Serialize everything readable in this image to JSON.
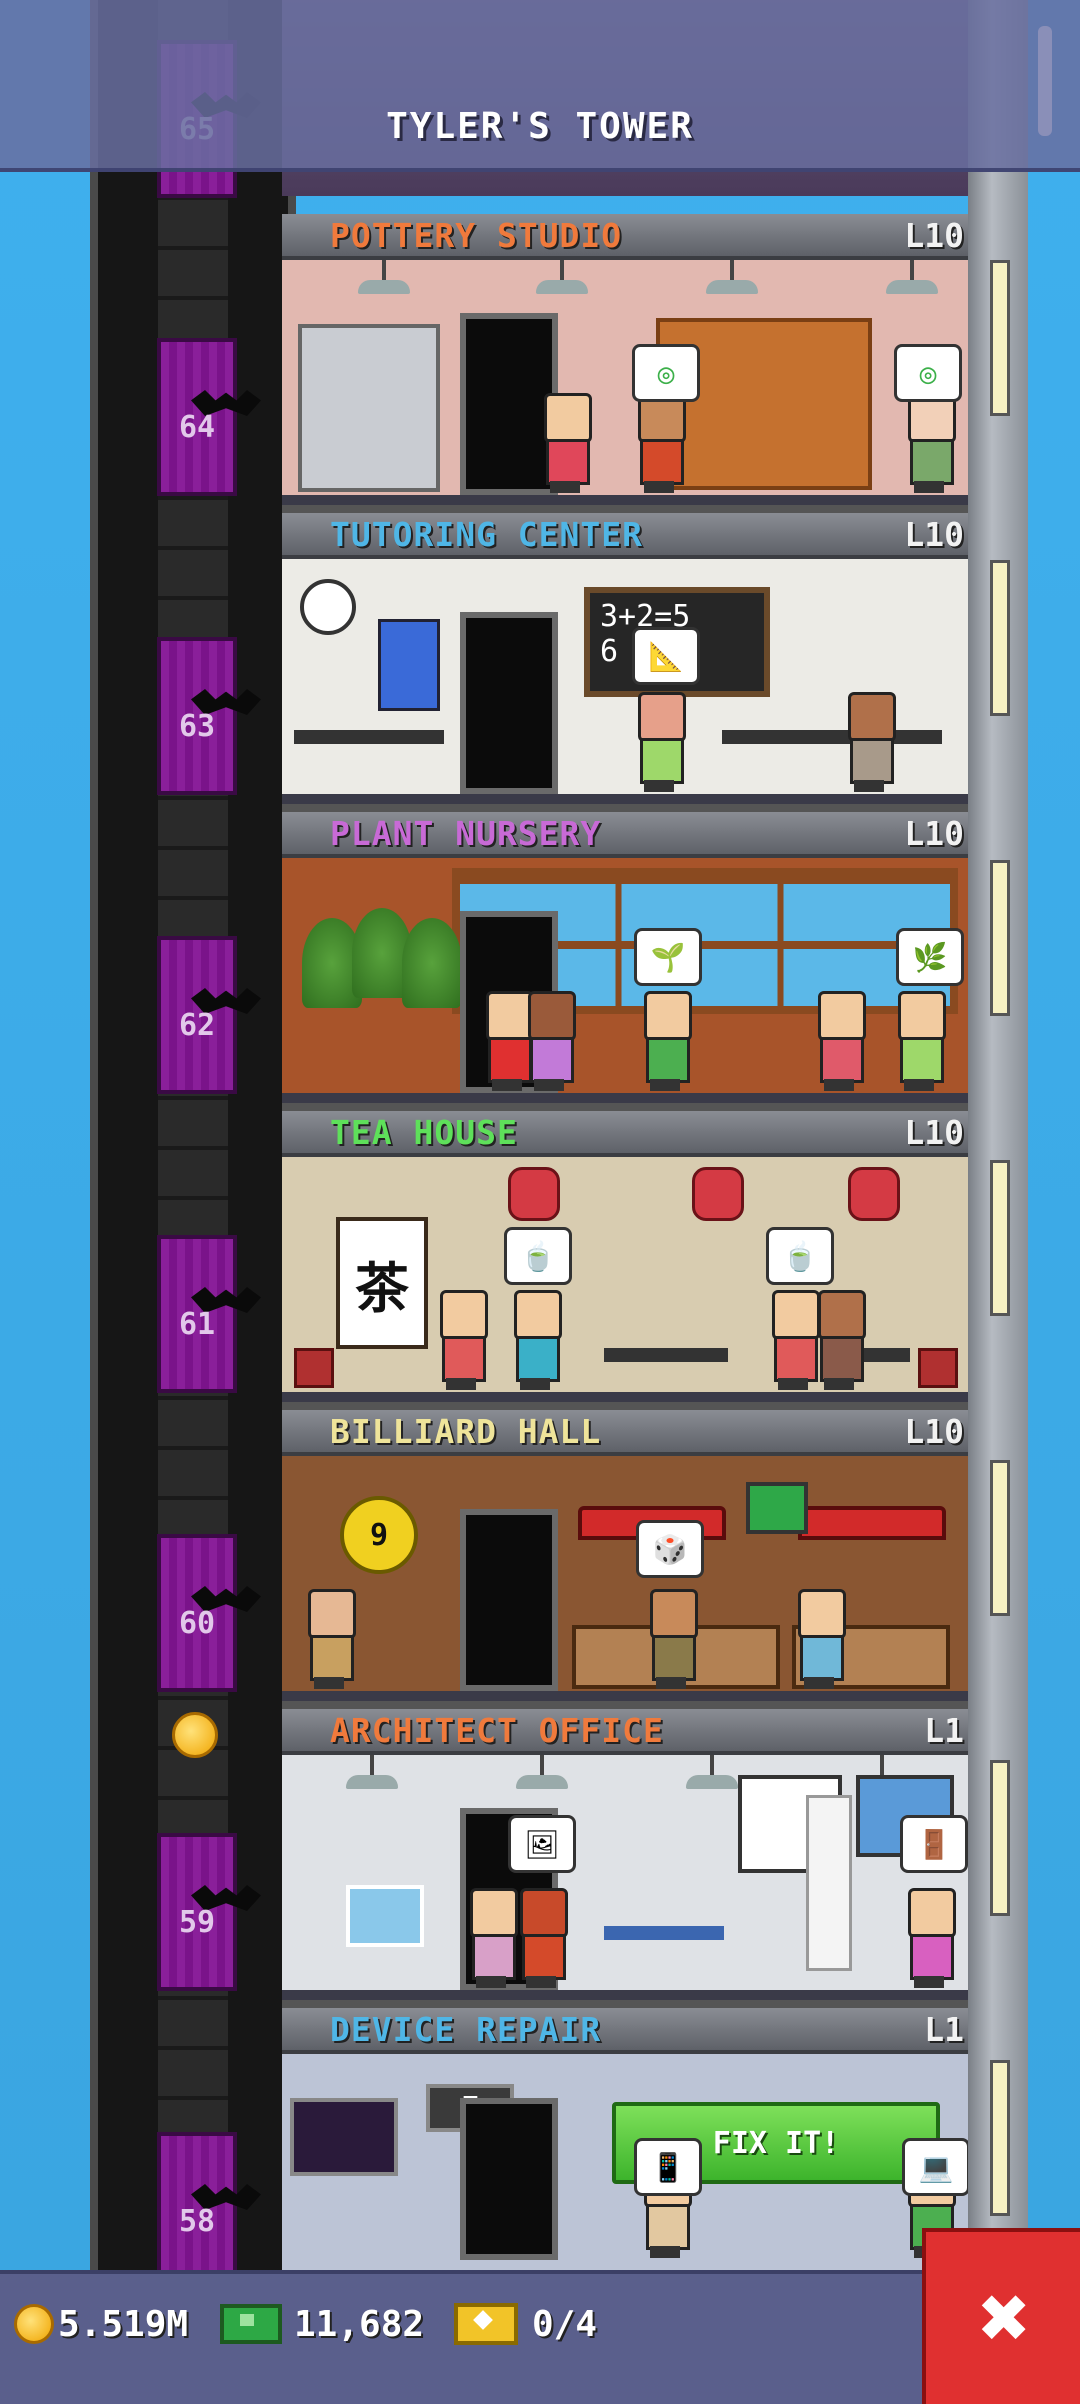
{
  "tower": {
    "name": "TYLER'S TOWER"
  },
  "elevator": {
    "floors": [
      {
        "number": "65"
      },
      {
        "number": "64"
      },
      {
        "number": "63"
      },
      {
        "number": "62"
      },
      {
        "number": "61"
      },
      {
        "number": "60"
      },
      {
        "number": "59"
      },
      {
        "number": "58"
      }
    ]
  },
  "floors": [
    {
      "name": "POTTERY STUDIO",
      "level": "L10",
      "color": "#f07a3c"
    },
    {
      "name": "TUTORING CENTER",
      "level": "L10",
      "color": "#4fb6e6"
    },
    {
      "name": "PLANT NURSERY",
      "level": "L10",
      "color": "#c86ad6"
    },
    {
      "name": "TEA HOUSE",
      "level": "L10",
      "color": "#5ee05a"
    },
    {
      "name": "BILLIARD HALL",
      "level": "L10",
      "color": "#efe49a"
    },
    {
      "name": "ARCHITECT OFFICE",
      "level": "L1",
      "color": "#f07a3c"
    },
    {
      "name": "DEVICE REPAIR",
      "level": "L1",
      "color": "#4fb6e6"
    }
  ],
  "tutoring": {
    "board_line1": "3+2=5",
    "board_line2": "6    36"
  },
  "billiard": {
    "ball_number": "9"
  },
  "tea": {
    "scroll_char": "茶"
  },
  "device_repair": {
    "fix_label": "FIX IT!",
    "sign_letter": "F"
  },
  "resources": {
    "coins": "5.519M",
    "bux": "11,682",
    "tickets": "0/4"
  },
  "close": {
    "label": "✖"
  }
}
